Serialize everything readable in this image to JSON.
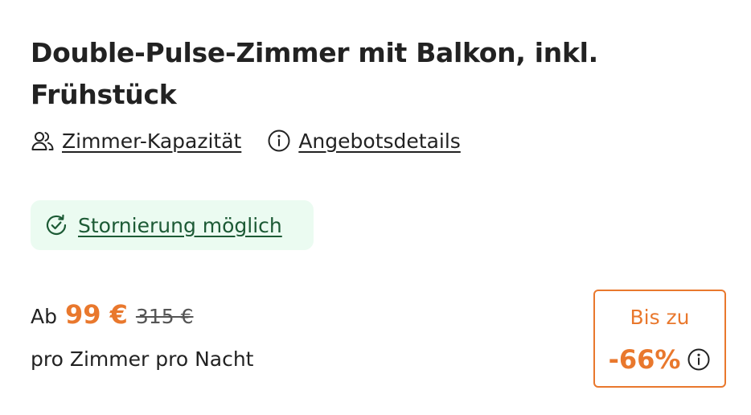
{
  "offer": {
    "title": "Double-Pulse-Zimmer mit Balkon, inkl. Frühstück",
    "links": {
      "capacity_label": "Zimmer-Kapazität",
      "capacity_icon": "users-icon",
      "details_label": "Angebotsdetails",
      "details_icon": "info-icon"
    },
    "cancellation": {
      "label": "Stornierung möglich",
      "icon": "check-circle-icon",
      "background_color": "#ebfbf1",
      "text_color": "#1c5a35"
    },
    "price": {
      "prefix": "Ab",
      "current": "99 €",
      "original": "315 €",
      "unit": "pro Zimmer pro Nacht",
      "accent_color": "#e9782d"
    },
    "discount": {
      "label": "Bis zu",
      "value": "-66%",
      "icon": "info-icon",
      "border_color": "#e9782d"
    }
  }
}
